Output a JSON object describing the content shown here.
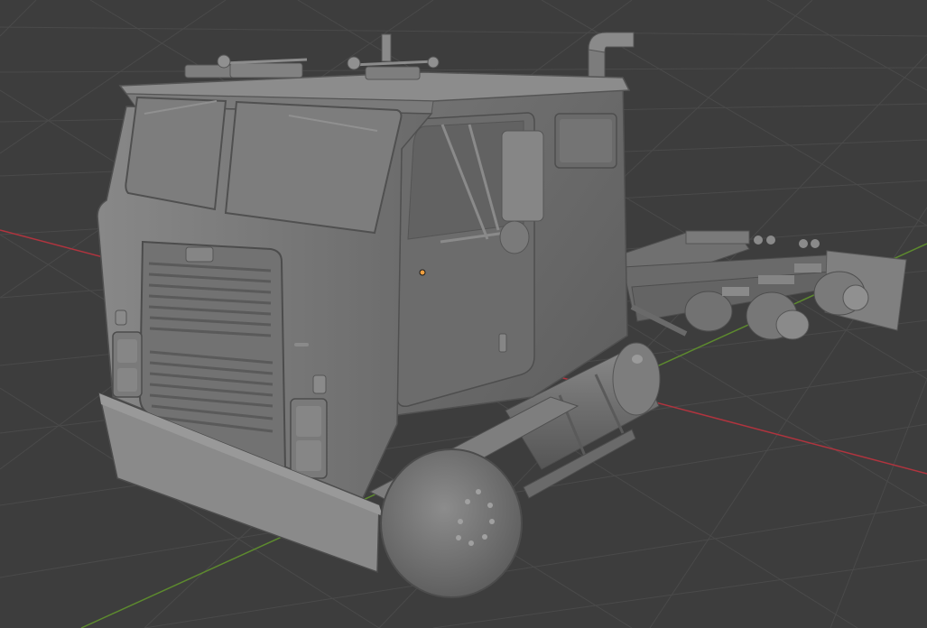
{
  "viewport": {
    "background": "#3d3d3d",
    "grid_color": "#4a4a4a",
    "x_axis_color": "#b0343e",
    "y_axis_color": "#5d8a2e",
    "origin_color": "#f0a040"
  },
  "scene": {
    "object": "truck-cab-model",
    "shading": "solid",
    "base_color": "#7b7b7b"
  }
}
